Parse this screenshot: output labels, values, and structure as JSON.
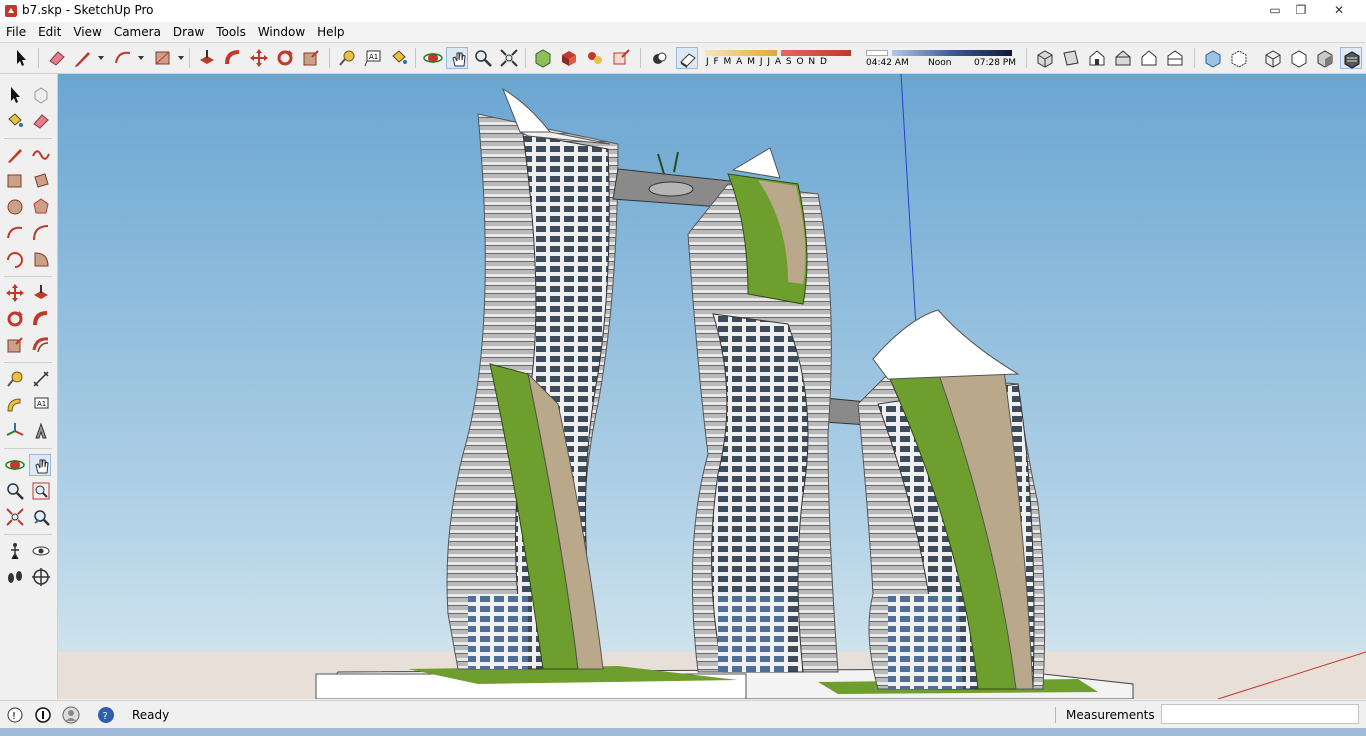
{
  "window": {
    "title": "b7.skp - SketchUp Pro",
    "controls": {
      "minimize": "▭",
      "restore": "❐",
      "close": "✕"
    }
  },
  "menu": [
    "File",
    "Edit",
    "View",
    "Camera",
    "Draw",
    "Tools",
    "Window",
    "Help"
  ],
  "toolbar": {
    "tools": [
      "select-icon",
      "eraser-icon",
      "pencil-icon",
      "arc-icon",
      "rectangle-icon",
      "push-pull-icon",
      "follow-me-icon",
      "move-icon",
      "rotate-icon",
      "scale-icon",
      "tape-measure-icon",
      "text-icon",
      "paint-bucket-icon",
      "orbit-icon",
      "pan-icon",
      "zoom-icon",
      "zoom-extents-icon",
      "3d-warehouse-icon",
      "extension-warehouse-icon",
      "components-icon",
      "share-icon",
      "shadow-toggle-icon",
      "shadow-settings-icon"
    ],
    "months": "J F M A M J J A S O N D",
    "time_start": "04:42 AM",
    "time_mid": "Noon",
    "time_end": "07:28 PM",
    "views": [
      "iso-view-icon",
      "top-view-icon",
      "front-view-icon",
      "right-view-icon",
      "back-view-icon",
      "left-view-icon"
    ],
    "styles": [
      "xray-icon",
      "back-edges-icon",
      "wireframe-icon",
      "hidden-line-icon",
      "shaded-icon",
      "shaded-textures-icon"
    ]
  },
  "status": {
    "ready": "Ready",
    "measurements_label": "Measurements",
    "measurements_value": ""
  },
  "colors": {
    "accent_red": "#c0392b",
    "sky_top": "#7fb4d8",
    "sky_bottom": "#cfe3ee",
    "ground": "#e6ded6",
    "facade_green": "#6e9f2e",
    "facade_tan": "#b9a98a"
  }
}
